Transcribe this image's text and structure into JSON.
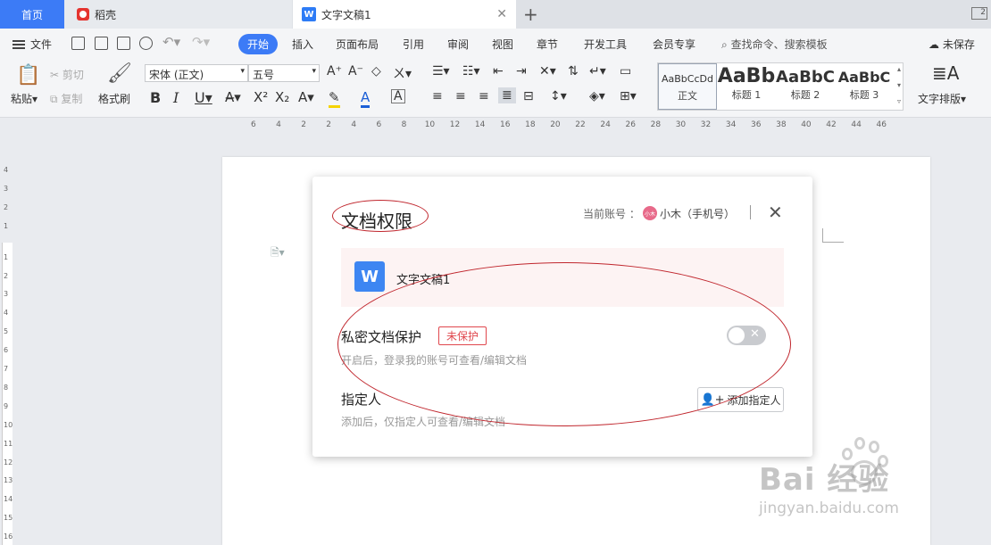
{
  "tabs": {
    "home": "首页",
    "daoke": "稻壳",
    "doc": "文字文稿1"
  },
  "menu": {
    "file": "文件",
    "tabs": [
      "开始",
      "插入",
      "页面布局",
      "引用",
      "审阅",
      "视图",
      "章节",
      "开发工具",
      "会员专享"
    ],
    "search_placeholder": "查找命令、搜索模板",
    "unsaved": "未保存"
  },
  "toolbar": {
    "paste": "粘贴",
    "cut": "剪切",
    "copy": "复制",
    "format_painter": "格式刷",
    "font_name": "宋体 (正文)",
    "font_size": "五号",
    "styles": [
      {
        "preview": "AaBbCcDd",
        "name": "正文"
      },
      {
        "preview": "AaBb",
        "name": "标题 1"
      },
      {
        "preview": "AaBbC",
        "name": "标题 2"
      },
      {
        "preview": "AaBbC",
        "name": "标题 3"
      }
    ],
    "text_layout": "文字排版"
  },
  "ruler": {
    "h_numbers": [
      "6",
      "4",
      "2",
      "2",
      "4",
      "6",
      "8",
      "10",
      "12",
      "14",
      "16",
      "18",
      "20",
      "22",
      "24",
      "26",
      "28",
      "30",
      "32",
      "34",
      "36",
      "38",
      "40",
      "42",
      "44",
      "46"
    ],
    "v_numbers": [
      "4",
      "3",
      "2",
      "1",
      "1",
      "2",
      "3",
      "4",
      "5",
      "6",
      "7",
      "8",
      "9",
      "10",
      "11",
      "12",
      "13",
      "14",
      "15",
      "16"
    ]
  },
  "dialog": {
    "title": "文档权限",
    "account_label": "当前账号 ：",
    "avatar_text": "小木",
    "account_name": "小木（手机号）",
    "doc_name": "文字文稿1",
    "private_title": "私密文档保护",
    "private_badge": "未保护",
    "private_desc": "开启后，登录我的账号可查看/编辑文档",
    "private_enabled": false,
    "assignee_title": "指定人",
    "add_assignee_btn": "添加指定人",
    "assignee_desc": "添加后，仅指定人可查看/编辑文档"
  },
  "watermark": {
    "logo": "Bai 经验",
    "url": "jingyan.baidu.com"
  }
}
